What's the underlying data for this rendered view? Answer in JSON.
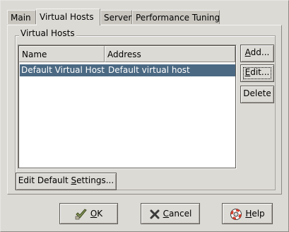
{
  "tabs": [
    {
      "label": "Main"
    },
    {
      "label": "Virtual Hosts"
    },
    {
      "label": "Server"
    },
    {
      "label": "Performance Tuning"
    }
  ],
  "frame": {
    "title": "Virtual Hosts"
  },
  "table": {
    "columns": [
      "Name",
      "Address"
    ],
    "rows": [
      {
        "name": "Default Virtual Host",
        "address": "Default virtual host"
      }
    ]
  },
  "side_buttons": {
    "add": {
      "mnemonic": "A",
      "rest": "dd..."
    },
    "edit": {
      "mnemonic": "E",
      "rest": "dit..."
    },
    "delete": {
      "label": "Delete"
    }
  },
  "edit_defaults": {
    "before": "Edit Default ",
    "mnemonic": "S",
    "rest": "ettings..."
  },
  "bottom_buttons": {
    "ok": {
      "mnemonic": "O",
      "rest": "K",
      "icon": "ok-icon"
    },
    "cancel": {
      "mnemonic": "C",
      "rest": "ancel",
      "icon": "cancel-icon"
    },
    "help": {
      "mnemonic": "H",
      "rest": "elp",
      "icon": "help-icon"
    }
  },
  "colors": {
    "selection": "#4b6983",
    "window": "#dcdad5"
  }
}
